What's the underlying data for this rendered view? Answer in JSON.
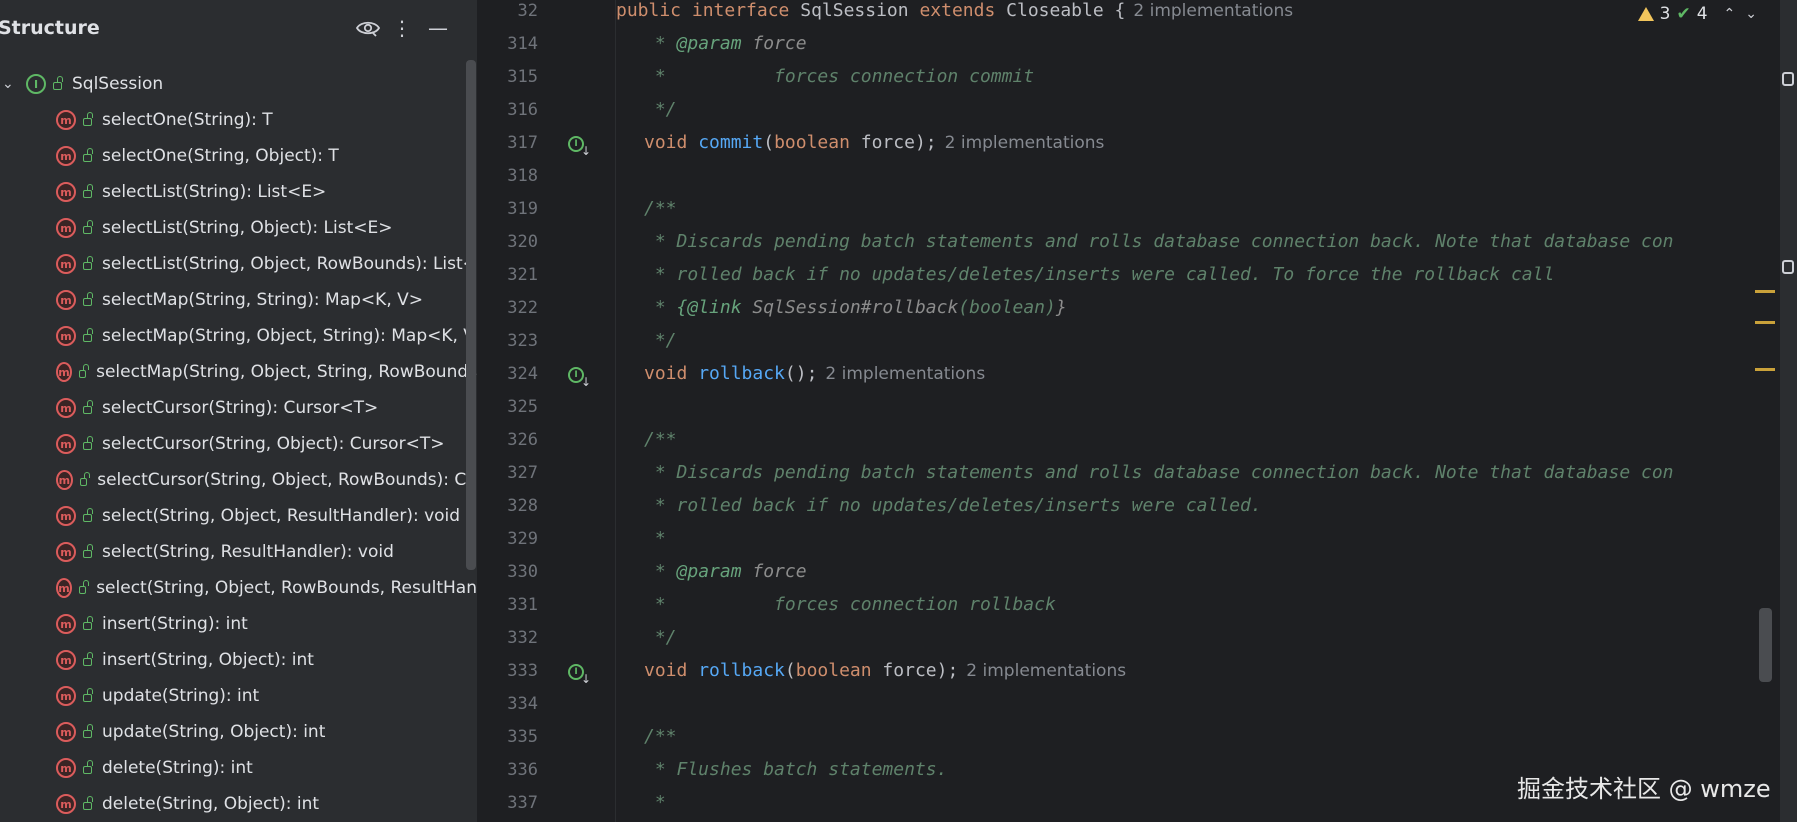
{
  "structure": {
    "title": "Structure",
    "root": "SqlSession",
    "methods": [
      "selectOne(String): T",
      "selectOne(String, Object): T",
      "selectList(String): List<E>",
      "selectList(String, Object): List<E>",
      "selectList(String, Object, RowBounds): List<",
      "selectMap(String, String): Map<K, V>",
      "selectMap(String, Object, String): Map<K, V",
      "selectMap(String, Object, String, RowBounds",
      "selectCursor(String): Cursor<T>",
      "selectCursor(String, Object): Cursor<T>",
      "selectCursor(String, Object, RowBounds): Cu",
      "select(String, Object, ResultHandler): void",
      "select(String, ResultHandler): void",
      "select(String, Object, RowBounds, ResultHan",
      "insert(String): int",
      "insert(String, Object): int",
      "update(String): int",
      "update(String, Object): int",
      "delete(String): int",
      "delete(String, Object): int"
    ]
  },
  "editor": {
    "sticky": {
      "ln": "32",
      "p1": "public interface ",
      "p2": "SqlSession ",
      "p3": "extends ",
      "p4": "Closeable {",
      "hint": "2 implementations"
    },
    "lines": [
      {
        "ln": "314",
        "a": " * ",
        "b": "@param",
        "c": " force"
      },
      {
        "ln": "315",
        "a": " *          forces connection commit"
      },
      {
        "ln": "316",
        "a": " */"
      },
      {
        "ln": "317",
        "kw": "void ",
        "fn": "commit",
        "p1": "(",
        "kw2": "boolean",
        "p2": " force);",
        "hint": "2 implementations"
      },
      {
        "ln": "318"
      },
      {
        "ln": "319",
        "a": "/**"
      },
      {
        "ln": "320",
        "a": " * Discards pending batch statements and rolls database connection back. Note that database con"
      },
      {
        "ln": "321",
        "a": " * rolled back if no updates/deletes/inserts were called. To force the rollback call"
      },
      {
        "ln": "322",
        "a": " * ",
        "b": "{@link",
        "c": " SqlSession#rollback",
        "d": "(boolean)",
        "e": "}"
      },
      {
        "ln": "323",
        "a": " */"
      },
      {
        "ln": "324",
        "kw": "void ",
        "fn": "rollback",
        "p1": "();",
        "hint": "2 implementations"
      },
      {
        "ln": "325"
      },
      {
        "ln": "326",
        "a": "/**"
      },
      {
        "ln": "327",
        "a": " * Discards pending batch statements and rolls database connection back. Note that database con"
      },
      {
        "ln": "328",
        "a": " * rolled back if no updates/deletes/inserts were called."
      },
      {
        "ln": "329",
        "a": " *"
      },
      {
        "ln": "330",
        "a": " * ",
        "b": "@param",
        "c": " force"
      },
      {
        "ln": "331",
        "a": " *          forces connection rollback"
      },
      {
        "ln": "332",
        "a": " */"
      },
      {
        "ln": "333",
        "kw": "void ",
        "fn": "rollback",
        "p1": "(",
        "kw2": "boolean",
        "p2": " force);",
        "hint": "2 implementations"
      },
      {
        "ln": "334"
      },
      {
        "ln": "335",
        "a": "/**"
      },
      {
        "ln": "336",
        "a": " * Flushes batch statements."
      },
      {
        "ln": "337",
        "a": " *"
      }
    ]
  },
  "inspections": {
    "warnings": "3",
    "ok": "4"
  },
  "watermark": "掘金技术社区 @ wmze",
  "colors": {
    "keyword": "#cf8e6d",
    "function": "#56a8f5",
    "comment": "#5f826b",
    "method_icon": "#db5c5c",
    "interface_icon": "#5fb865"
  },
  "icons": [
    "eye-icon",
    "more-vertical-icon",
    "minimize-icon",
    "chevron-down-icon",
    "interface-icon",
    "method-icon",
    "lock-icon",
    "implemented-down-icon",
    "warning-icon",
    "check-icon",
    "chevron-up-icon"
  ]
}
